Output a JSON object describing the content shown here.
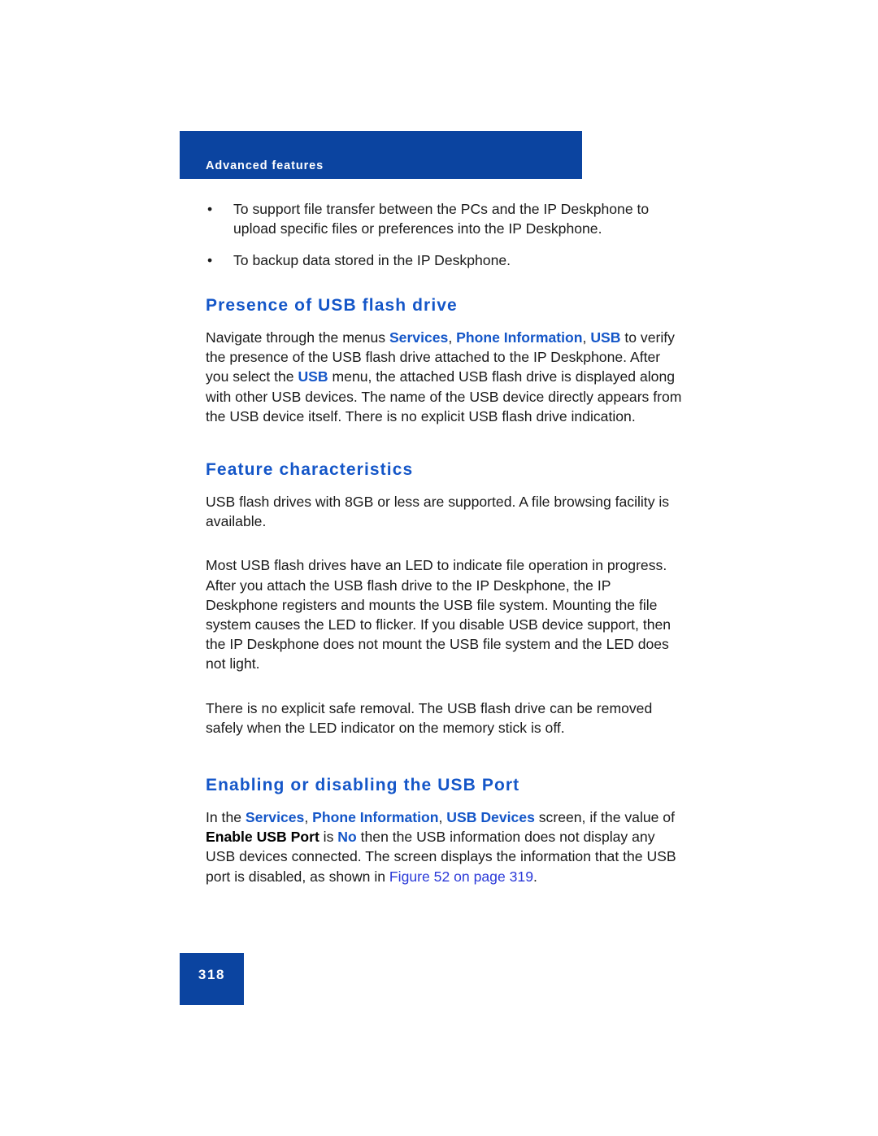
{
  "page": {
    "running_header": "Advanced features",
    "page_number": "318"
  },
  "colors": {
    "header_bar_blue": "#0b44a0",
    "heading_blue": "#1456c8",
    "menu_term_blue": "#1456c8",
    "link_blue": "#2a39d8",
    "body_black": "#1a1a1a"
  },
  "bullets": {
    "marker": "•",
    "items": [
      "To support file transfer between the PCs and the IP Deskphone to upload specific files or preferences into the IP Deskphone.",
      "To backup data stored in the IP Deskphone."
    ]
  },
  "sections": [
    {
      "heading": "Presence of USB flash drive",
      "paragraph_runs": [
        {
          "text": "Navigate through the menus ",
          "style": "plain"
        },
        {
          "text": "Services",
          "style": "menu-term"
        },
        {
          "text": ", ",
          "style": "plain"
        },
        {
          "text": "Phone Information",
          "style": "menu-term"
        },
        {
          "text": ", ",
          "style": "plain"
        },
        {
          "text": "USB",
          "style": "menu-term"
        },
        {
          "text": " to verify the presence of the USB flash drive attached to the IP Deskphone. After you select the ",
          "style": "plain"
        },
        {
          "text": "USB",
          "style": "menu-term"
        },
        {
          "text": " menu, the attached USB flash drive is displayed along with other USB devices. The name of the USB device directly appears from the USB device itself. There is no explicit USB flash drive indication.",
          "style": "plain"
        }
      ]
    },
    {
      "heading": "Feature characteristics",
      "paragraphs": [
        "USB flash drives with 8GB or less are supported. A file browsing facility is available.",
        "Most USB flash drives have an LED to indicate file operation in progress. After you attach the USB flash drive to the IP Deskphone, the IP Deskphone registers and mounts the USB file system. Mounting the file system causes the LED to flicker. If you disable USB device support, then the IP Deskphone does not mount the USB file system and the LED does not light.",
        "There is no explicit safe removal. The USB flash drive can be removed safely when the LED indicator on the memory stick is off."
      ]
    },
    {
      "heading": "Enabling or disabling the USB Port",
      "paragraph_runs": [
        {
          "text": "In the ",
          "style": "plain"
        },
        {
          "text": "Services",
          "style": "menu-term"
        },
        {
          "text": ", ",
          "style": "plain"
        },
        {
          "text": "Phone Information",
          "style": "menu-term"
        },
        {
          "text": ", ",
          "style": "plain"
        },
        {
          "text": "USB Devices",
          "style": "menu-term"
        },
        {
          "text": " screen, if the value of ",
          "style": "plain"
        },
        {
          "text": "Enable USB Port",
          "style": "bold-black"
        },
        {
          "text": " is ",
          "style": "plain"
        },
        {
          "text": "No",
          "style": "value-term"
        },
        {
          "text": " then the USB information does not display any USB devices connected. The screen displays the information that the USB port is disabled, as shown in ",
          "style": "plain"
        },
        {
          "text": "Figure 52 on page 319",
          "style": "xref-link"
        },
        {
          "text": ".",
          "style": "plain"
        }
      ]
    }
  ]
}
